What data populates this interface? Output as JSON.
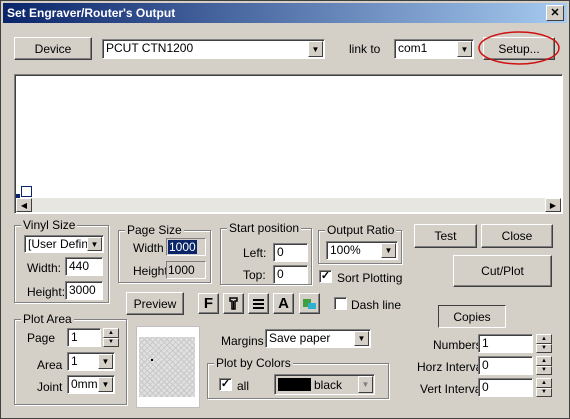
{
  "window": {
    "title": "Set Engraver/Router's Output"
  },
  "top": {
    "device_label": "Device",
    "device_value": "PCUT CTN1200",
    "link_label": "link to",
    "port_value": "com1",
    "setup_label": "Setup..."
  },
  "vinyl": {
    "title": "Vinyl Size",
    "type_value": "[User Define",
    "width_label": "Width:",
    "width_value": "440",
    "height_label": "Height:",
    "height_value": "3000"
  },
  "page_size": {
    "title": "Page Size",
    "width_label": "Width",
    "width_value": "1000",
    "height_label": "Height",
    "height_value": "1000"
  },
  "start": {
    "title": "Start position",
    "left_label": "Left:",
    "left_value": "0",
    "top_label": "Top:",
    "top_value": "0"
  },
  "ratio": {
    "title": "Output Ratio",
    "value": "100%",
    "sort_label": "Sort Plotting",
    "sort_checked": true,
    "dash_label": "Dash line",
    "dash_checked": false
  },
  "buttons": {
    "test": "Test",
    "close": "Close",
    "cutplot": "Cut/Plot",
    "preview": "Preview",
    "copies": "Copies"
  },
  "toolbar": {
    "font_glyph": "F",
    "text_glyph": "A"
  },
  "plot_area": {
    "title": "Plot Area",
    "page_label": "Page",
    "page_value": "1",
    "area_label": "Area",
    "area_value": "1",
    "joint_label": "Joint",
    "joint_value": "0mm"
  },
  "margins": {
    "label": "Margins",
    "value": "Save paper"
  },
  "plot_colors": {
    "title": "Plot by Colors",
    "all_label": "all",
    "all_checked": true,
    "color_name": "black",
    "color_swatch": "#000000"
  },
  "copies": {
    "numbers_label": "Numbers",
    "numbers_value": "1",
    "horz_label": "Horz Interval",
    "horz_value": "0",
    "vert_label": "Vert Interval",
    "vert_value": "0"
  },
  "colors": {
    "title_start": "#0a246a",
    "title_end": "#a6caf0",
    "highlight_circle": "#d01010",
    "selection": "#0a246a"
  }
}
